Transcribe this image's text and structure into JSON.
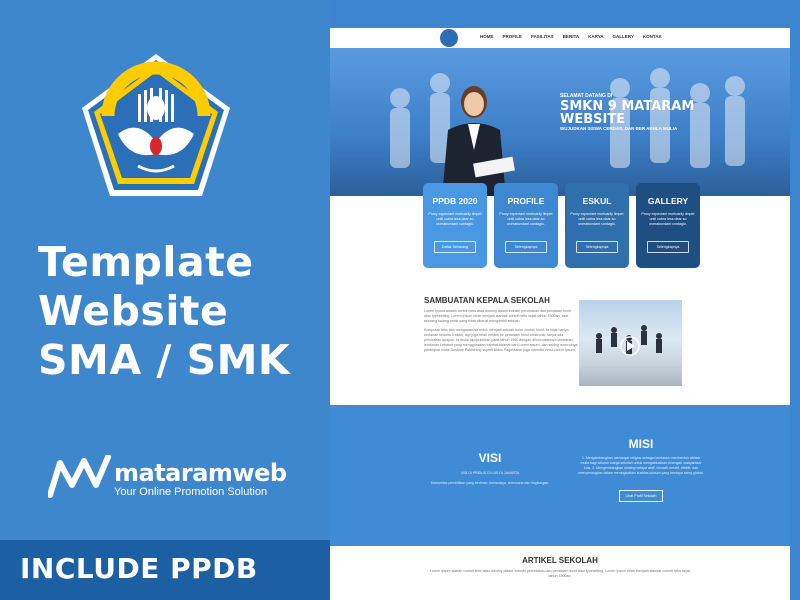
{
  "promo": {
    "logo_text": "TUT WURI HANDAYANI",
    "title_lines": [
      "Template",
      "Website",
      "SMA / SMK"
    ],
    "brand_name": "mataramweb",
    "brand_tagline": "Your Online Promotion Solution",
    "include_label": "INCLUDE PPDB"
  },
  "site": {
    "nav": [
      "HOME",
      "PROFILE",
      "FASILITAS",
      "BERITA",
      "KARYA",
      "GALLERY",
      "KONTAK"
    ],
    "hero": {
      "welcome": "SELAMAT DATANG DI",
      "title_line1": "SMKN 9 MATARAM",
      "title_line2": "WEBSITE",
      "subtitle": "WUJUDKAN SISWA CERDAS, DAN BER AKHLA MULIA"
    },
    "cards": [
      {
        "title": "PPDB 2020",
        "text": "Proxy expectant mortuarily limpet until cobra less dear so overabundant contagio.",
        "button": "Daftar Sekarang",
        "color": "#4a98e3"
      },
      {
        "title": "PROFILE",
        "text": "Proxy expectant mortuarily limpet until cobra less dear so overabundant contagio.",
        "button": "Selengkapnya",
        "color": "#3d88d0"
      },
      {
        "title": "ESKUL",
        "text": "Proxy expectant mortuarily limpet until cobra less dear so overabundant contagio.",
        "button": "Selengkapnya",
        "color": "#2f6fad"
      },
      {
        "title": "GALLERY",
        "text": "Proxy expectant mortuarily limpet until cobra less dear so overabundant contagio.",
        "button": "Selengkapnya",
        "color": "#1f4f82"
      }
    ],
    "sambutan": {
      "heading": "SAMBUATAN KEPALA SEKOLAH",
      "para1": "Lorem Ipsum adalah contoh teks atau dummy dalam industri percetakan dan penataan huruf atau typesetting. Lorem Ipsum telah menjadi standar contoh teks sejak tahun 1500an, saat seorang tukang cetak yang tidak dikenal mengambil sebuah.",
      "para2": "Kumpulan teks dan mengacaknya untuk menjadi sebuah buku contoh huruf. Ia tidak hanya bertahan selama 5 abad, tapi juga telah beralih ke penataan huruf elektronik, tanpa ada perubahan apapun. Ia mulai dipopulerkan pada tahun 1960 dengan diluncurkannya lembaran-lembaran Letraset yang menggunakan kalimat-kalimat dari Lorem Ipsum, dan seiring munculnya perangkat lunak Desktop Publishing seperti Aldus PageMaker juga memiliki versi Lorem Ipsum."
    },
    "visi": {
      "heading": "VISI",
      "subheading": "VISI DI PRIDUS DI LUS DI JAKARTA",
      "text": "Komunitas pendidikan yang beriman, berbudaya, terencana dan lingkungan."
    },
    "misi": {
      "heading": "MISI",
      "text": "1. Mengembangkan semangat religius sebagai landasan membentuk akhlak mulia bagi seluruh warga sekolah untuk mengaktualkan di tengah masyarakat luas. 2. Mengembangkan strategi belajar aktif, inovatif, kreatif, efektif, dan menyenangkan dalam meningkatkan kualitas lulusan yang berdaya saing global.",
      "button": "Lihat Profil Sekolah"
    },
    "artikel": {
      "heading": "ARTIKEL SEKOLAH",
      "text": "Lorem ipsum adalah contoh teks atau dummy dalam industri percetakan dan penataan huruf atau typesetting. Lorem Ipsum telah menjadi standar contoh teks sejak tahun 1500an."
    }
  }
}
